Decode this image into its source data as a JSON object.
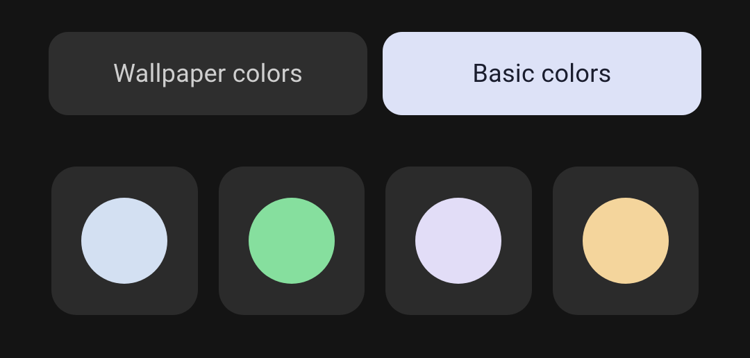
{
  "tabs": {
    "wallpaper": {
      "label": "Wallpaper colors",
      "selected": false
    },
    "basic": {
      "label": "Basic colors",
      "selected": true
    }
  },
  "swatches": [
    {
      "name": "blue",
      "color": "#d3e0f2"
    },
    {
      "name": "green",
      "color": "#86df9e"
    },
    {
      "name": "lilac",
      "color": "#e2ddf7"
    },
    {
      "name": "peach",
      "color": "#f4d59c"
    }
  ]
}
